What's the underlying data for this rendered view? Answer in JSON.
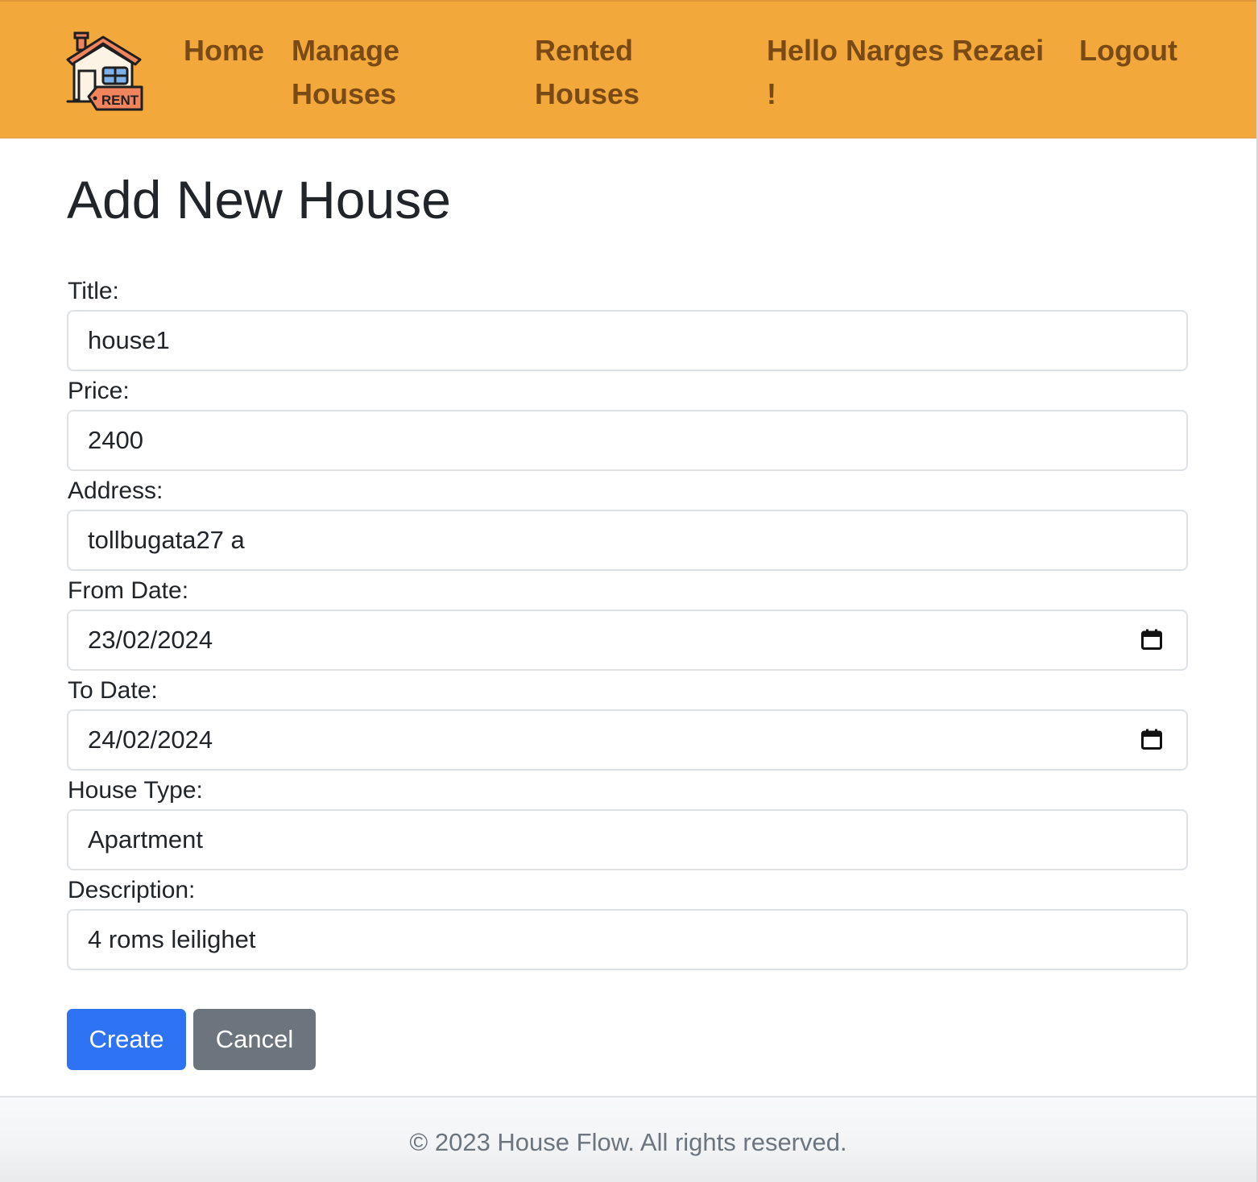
{
  "navbar": {
    "logo_text": "RENT",
    "links": {
      "home": "Home",
      "manage_houses": "Manage Houses",
      "rented_houses": "Rented Houses",
      "greeting": "Hello Narges Rezaei !",
      "logout": "Logout"
    },
    "colors": {
      "background": "#f2a83a",
      "link": "#7a4a16"
    }
  },
  "form": {
    "heading": "Add New House",
    "fields": {
      "title": {
        "label": "Title:",
        "value": "house1"
      },
      "price": {
        "label": "Price:",
        "value": "2400"
      },
      "address": {
        "label": "Address:",
        "value": "tollbugata27 a"
      },
      "from_date": {
        "label": "From Date:",
        "value": "23/02/2024",
        "icon": "calendar-icon"
      },
      "to_date": {
        "label": "To Date:",
        "value": "24/02/2024",
        "icon": "calendar-icon"
      },
      "house_type": {
        "label": "House Type:",
        "value": "Apartment"
      },
      "description": {
        "label": "Description:",
        "value": "4 roms leilighet"
      }
    },
    "buttons": {
      "create": "Create",
      "cancel": "Cancel"
    },
    "colors": {
      "primary": "#2f73f5",
      "secondary": "#6c757d"
    }
  },
  "footer": {
    "text": "© 2023 House Flow. All rights reserved."
  }
}
